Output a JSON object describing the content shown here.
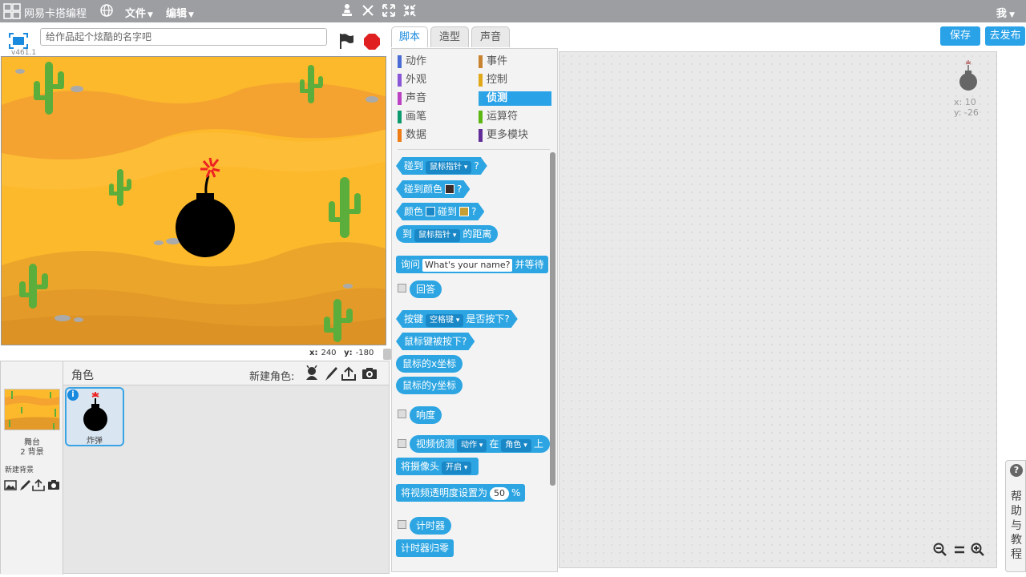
{
  "topbar": {
    "brand": "网易卡搭编程",
    "file_menu": "文件",
    "edit_menu": "编辑",
    "user": "我"
  },
  "stage_header": {
    "version": "v461.1",
    "title_placeholder": "给作品起个炫酷的名字吧"
  },
  "stage_coords": {
    "x_label": "x:",
    "x_value": "240",
    "y_label": "y:",
    "y_value": "-180"
  },
  "sprite_panel": {
    "header_label": "角色",
    "new_sprite_label": "新建角色:",
    "stage_name": "舞台",
    "stage_backdrops": "2 背景",
    "new_backdrop_label": "新建背景",
    "sprite_name": "炸弹"
  },
  "tabs": {
    "scripts": "脚本",
    "costumes": "造型",
    "sounds": "声音"
  },
  "buttons": {
    "save": "保存",
    "publish": "去发布"
  },
  "categories": [
    {
      "label": "动作",
      "color": "#4a6cd4"
    },
    {
      "label": "外观",
      "color": "#8a55d7"
    },
    {
      "label": "声音",
      "color": "#bb42c3"
    },
    {
      "label": "画笔",
      "color": "#0e9a6c"
    },
    {
      "label": "数据",
      "color": "#ee7d16"
    },
    {
      "label": "事件",
      "color": "#c88330"
    },
    {
      "label": "控制",
      "color": "#e1a91a"
    },
    {
      "label": "侦测",
      "color": "#2ca5e2"
    },
    {
      "label": "运算符",
      "color": "#5cb712"
    },
    {
      "label": "更多模块",
      "color": "#632d99"
    }
  ],
  "blocks": {
    "touching": {
      "a": "碰到",
      "dd": "鼠标指针",
      "b": "?"
    },
    "touching_color": {
      "a": "碰到颜色",
      "b": "?"
    },
    "color_touching": {
      "a": "颜色",
      "b": "碰到",
      "c": "?"
    },
    "distance": {
      "a": "到",
      "dd": "鼠标指针",
      "b": "的距离"
    },
    "ask": {
      "a": "询问",
      "input": "What's your name?",
      "b": "并等待"
    },
    "answer": "回答",
    "key_pressed": {
      "a": "按键",
      "dd": "空格键",
      "b": "是否按下?"
    },
    "mouse_down": "鼠标键被按下?",
    "mouse_x": "鼠标的x坐标",
    "mouse_y": "鼠标的y坐标",
    "loudness": "响度",
    "video": {
      "a": "视频侦测",
      "dd1": "动作",
      "b": "在",
      "dd2": "角色",
      "c": "上"
    },
    "camera": {
      "a": "将摄像头",
      "dd": "开启"
    },
    "transparency": {
      "a": "将视频透明度设置为",
      "num": "50",
      "b": "%"
    },
    "timer": "计时器",
    "reset_timer": "计时器归零"
  },
  "script_area": {
    "x_label": "x: 10",
    "y_label": "y: -26"
  },
  "help": {
    "label": "帮助与教程"
  }
}
